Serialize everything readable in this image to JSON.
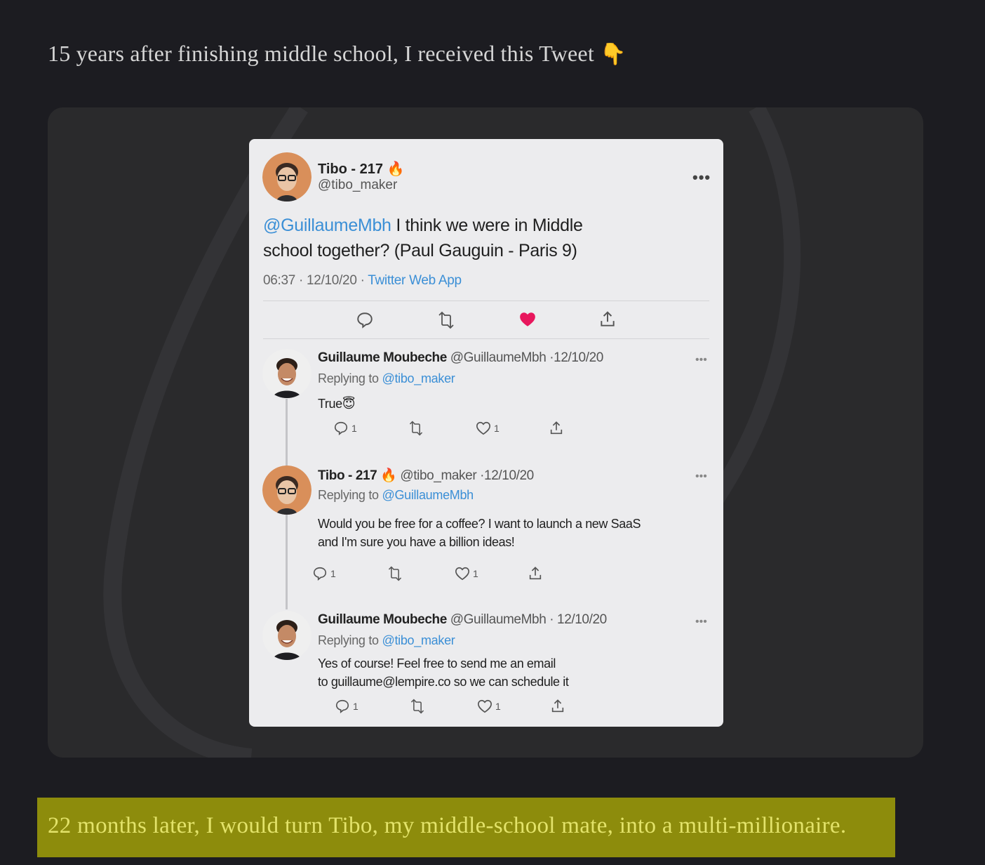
{
  "headline": {
    "text": "15 years after finishing middle school, I received this Tweet",
    "emoji": "👇"
  },
  "main_tweet": {
    "display_name": "Tibo - 217",
    "name_emoji": "🔥",
    "handle": "@tibo_maker",
    "more": "•••",
    "mention": "@GuillaumeMbh",
    "text_line1": " I think we were in Middle",
    "text_line2": "school together? (Paul Gauguin - Paris 9)",
    "meta": "06:37 · 12/10/20 · ",
    "source": "Twitter Web App",
    "liked_color": "#e8175d"
  },
  "replies": [
    {
      "name": "Guillaume Moubeche",
      "handle_date": " @GuillaumeMbh ·12/10/20",
      "replying_label": "Replying to ",
      "replying_to": "@tibo_maker",
      "text_line1": "True",
      "text_emoji": "😇",
      "reply_count": "1",
      "like_count": "1",
      "more": "•••"
    },
    {
      "name": "Tibo - 217",
      "name_emoji": "🔥",
      "handle_date": " @tibo_maker ·12/10/20",
      "replying_label": "Replying to ",
      "replying_to": "@GuillaumeMbh",
      "text_line1": "Would you be free for a coffee? I want to launch a new SaaS",
      "text_line2": "and I'm sure you have a billion ideas!",
      "reply_count": "1",
      "like_count": "1",
      "more": "•••"
    },
    {
      "name": "Guillaume Moubeche",
      "handle_date": " @GuillaumeMbh · 12/10/20",
      "replying_label": "Replying to ",
      "replying_to": "@tibo_maker",
      "text_line1": "Yes of course! Feel free to send me an email",
      "text_line2": "to guillaume@lempire.co so we can schedule it",
      "reply_count": "1",
      "like_count": "1",
      "more": "•••"
    }
  ],
  "banner": {
    "text": "22 months later, I would turn Tibo, my middle-school mate, into a multi-millionaire."
  }
}
